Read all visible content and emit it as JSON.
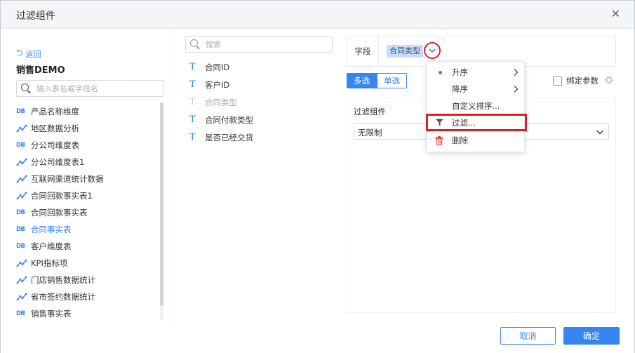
{
  "dialog": {
    "title": "过滤组件",
    "close_glyph": "✕"
  },
  "left_panel": {
    "back_label": "返回",
    "datasource_title": "销售DEMO",
    "search_placeholder": "输入表名或字段名",
    "tables": [
      {
        "label": "产品名称维度",
        "icon": "db-icon",
        "active": false
      },
      {
        "label": "地区数据分析",
        "icon": "line-chart-icon",
        "active": false
      },
      {
        "label": "分公司维度表",
        "icon": "db-icon",
        "active": false
      },
      {
        "label": "分公司维度表1",
        "icon": "line-chart-icon",
        "active": false
      },
      {
        "label": "互联网渠道统计数据",
        "icon": "line-chart-icon",
        "active": false
      },
      {
        "label": "合同回款事实表1",
        "icon": "line-chart-icon",
        "active": false
      },
      {
        "label": "合同回款事实表",
        "icon": "db-icon",
        "active": false
      },
      {
        "label": "合同事实表",
        "icon": "db-icon",
        "active": true
      },
      {
        "label": "客户维度表",
        "icon": "db-icon",
        "active": false
      },
      {
        "label": "KPI指标项",
        "icon": "line-chart-icon",
        "active": false
      },
      {
        "label": "门店销售数据统计",
        "icon": "line-chart-icon",
        "active": false
      },
      {
        "label": "省市签约数据统计",
        "icon": "line-chart-icon",
        "active": false
      },
      {
        "label": "销售事实表",
        "icon": "db-icon",
        "active": false
      }
    ],
    "db_icon_text": "DB"
  },
  "middle_panel": {
    "search_placeholder": "搜索",
    "text_icon_glyph": "T",
    "fields": [
      {
        "label": "合同ID",
        "disabled": false
      },
      {
        "label": "客户ID",
        "disabled": false
      },
      {
        "label": "合同类型",
        "disabled": true
      },
      {
        "label": "合同付款类型",
        "disabled": false
      },
      {
        "label": "是否已经交货",
        "disabled": false
      }
    ]
  },
  "right_panel": {
    "field_label": "字段",
    "field_chip": "合同类型",
    "mode_multi": "多选",
    "mode_single": "单选",
    "bind_param_label": "绑定参数",
    "component_title": "过滤组件",
    "component_value": "无限制"
  },
  "dropdown_menu": {
    "items": [
      {
        "label": "升序",
        "selected": true,
        "submenu": true
      },
      {
        "label": "降序",
        "selected": false,
        "submenu": true
      },
      {
        "label": "自定义排序...",
        "selected": false,
        "submenu": false
      },
      {
        "label": "过滤...",
        "selected": false,
        "submenu": false,
        "icon": "filter-icon",
        "highlighted": true
      },
      {
        "label": "删除",
        "selected": false,
        "submenu": false,
        "icon": "trash-icon"
      }
    ]
  },
  "footer": {
    "cancel_label": "取消",
    "ok_label": "确定"
  },
  "colors": {
    "accent": "#3685f2",
    "highlight_red": "#e02020",
    "chip_bg": "#c7dcfa"
  }
}
